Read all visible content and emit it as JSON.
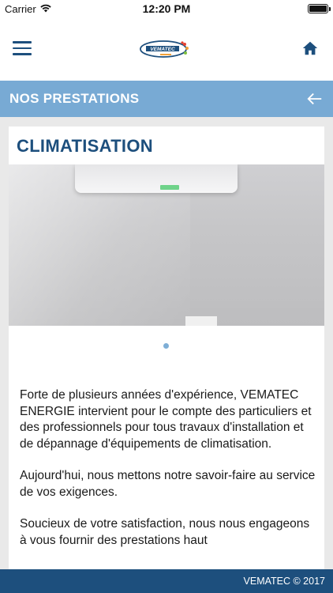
{
  "status_bar": {
    "carrier": "Carrier",
    "time": "12:20 PM",
    "icons": [
      "wifi-icon",
      "battery-icon"
    ],
    "battery_level": 1.0
  },
  "nav": {
    "logo_text": "VEMATEC",
    "menu_icon": "hamburger-menu-icon",
    "home_icon": "home-icon"
  },
  "section": {
    "title": "NOS PRESTATIONS",
    "back_icon": "arrow-left-icon"
  },
  "card": {
    "title": "CLIMATISATION",
    "paragraphs": [
      "Forte de plusieurs années d'expérience, VEMATEC ENERGIE intervient pour le compte des particuliers et des professionnels pour tous travaux d'installation et de dépannage d'équipements de climatisation.",
      "Aujourd'hui, nous mettons notre savoir-faire au service de vos exigences.",
      "Soucieux de votre satisfaction, nous nous engageons à vous fournir des prestations haut"
    ],
    "carousel_pages": 1,
    "carousel_active": 1
  },
  "footer": {
    "copyright": "VEMATEC © 2017"
  },
  "colors": {
    "brand_blue": "#1d4f7d",
    "section_blue": "#78aad4",
    "page_bg": "#e9e9e9"
  }
}
